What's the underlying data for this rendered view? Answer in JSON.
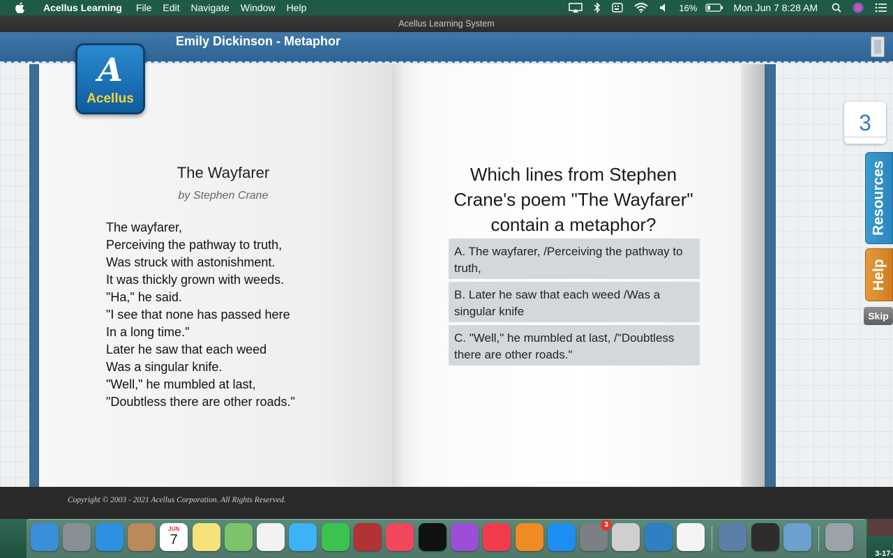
{
  "menubar": {
    "app_name": "Acellus Learning",
    "menus": [
      "File",
      "Edit",
      "Navigate",
      "Window",
      "Help"
    ],
    "battery": "16%",
    "clock": "Mon Jun 7  8:28 AM"
  },
  "window": {
    "title": "Acellus Learning System"
  },
  "lesson": {
    "title": "Emily Dickinson - Metaphor"
  },
  "logo": {
    "text": "Acellus"
  },
  "poem": {
    "title": "The Wayfarer",
    "author": "by Stephen Crane",
    "lines": [
      "The wayfarer,",
      "Perceiving the pathway to truth,",
      "Was struck with astonishment.",
      "It was thickly grown with weeds.",
      "\"Ha,\" he said.",
      "\"I see that none has passed here",
      "In a long time.\"",
      "Later he saw that each weed",
      "Was a singular knife.",
      "\"Well,\" he mumbled at last,",
      "\"Doubtless there are other roads.\""
    ]
  },
  "question": {
    "text": "Which lines from Stephen Crane's poem \"The Wayfarer\" contain a metaphor?",
    "choices": [
      "A.  The wayfarer, /Perceiving the pathway to truth,",
      "B.  Later he saw that each weed /Was a singular knife",
      "C.  \"Well,\" he mumbled at last, /\"Doubtless there are other roads.\""
    ]
  },
  "sidebar": {
    "counter": "3",
    "resources_label": "Resources",
    "help_label": "Help",
    "skip_label": "Skip"
  },
  "footer": {
    "copyright": "Copyright © 2003 - 2021 Acellus Corporation.  All Rights Reserved."
  },
  "dock": {
    "calendar_month": "JUN",
    "calendar_day": "7",
    "system_prefs_badge": "3",
    "corner_label": "3-17-",
    "apps": [
      {
        "name": "finder",
        "color": "#3b8fd8"
      },
      {
        "name": "launchpad",
        "color": "#8a8f96"
      },
      {
        "name": "safari",
        "color": "#2f8fe0"
      },
      {
        "name": "contacts",
        "color": "#b98a5a"
      },
      {
        "name": "calendar",
        "color": "#ffffff"
      },
      {
        "name": "notes",
        "color": "#f6e27a"
      },
      {
        "name": "maps",
        "color": "#7cc36b"
      },
      {
        "name": "photos",
        "color": "#f2f2f2"
      },
      {
        "name": "messages",
        "color": "#3fb1f5"
      },
      {
        "name": "facetime",
        "color": "#3cc24f"
      },
      {
        "name": "photo-booth",
        "color": "#b23333"
      },
      {
        "name": "music",
        "color": "#f2475c"
      },
      {
        "name": "apple-tv",
        "color": "#111111"
      },
      {
        "name": "podcasts",
        "color": "#9b4fd6"
      },
      {
        "name": "news",
        "color": "#f23c4d"
      },
      {
        "name": "books",
        "color": "#f08a24"
      },
      {
        "name": "app-store",
        "color": "#1f8ef2"
      },
      {
        "name": "system-preferences",
        "color": "#7c7f84"
      },
      {
        "name": "roblox",
        "color": "#cfcfcf"
      },
      {
        "name": "acellus",
        "color": "#2f7fc2"
      },
      {
        "name": "chrome",
        "color": "#f4f4f4"
      },
      {
        "name": "preview",
        "color": "#5b7fa6"
      },
      {
        "name": "quicktime",
        "color": "#2d2d2d"
      },
      {
        "name": "mail",
        "color": "#6da0cf"
      },
      {
        "name": "trash",
        "color": "#9aa3aa"
      }
    ]
  }
}
